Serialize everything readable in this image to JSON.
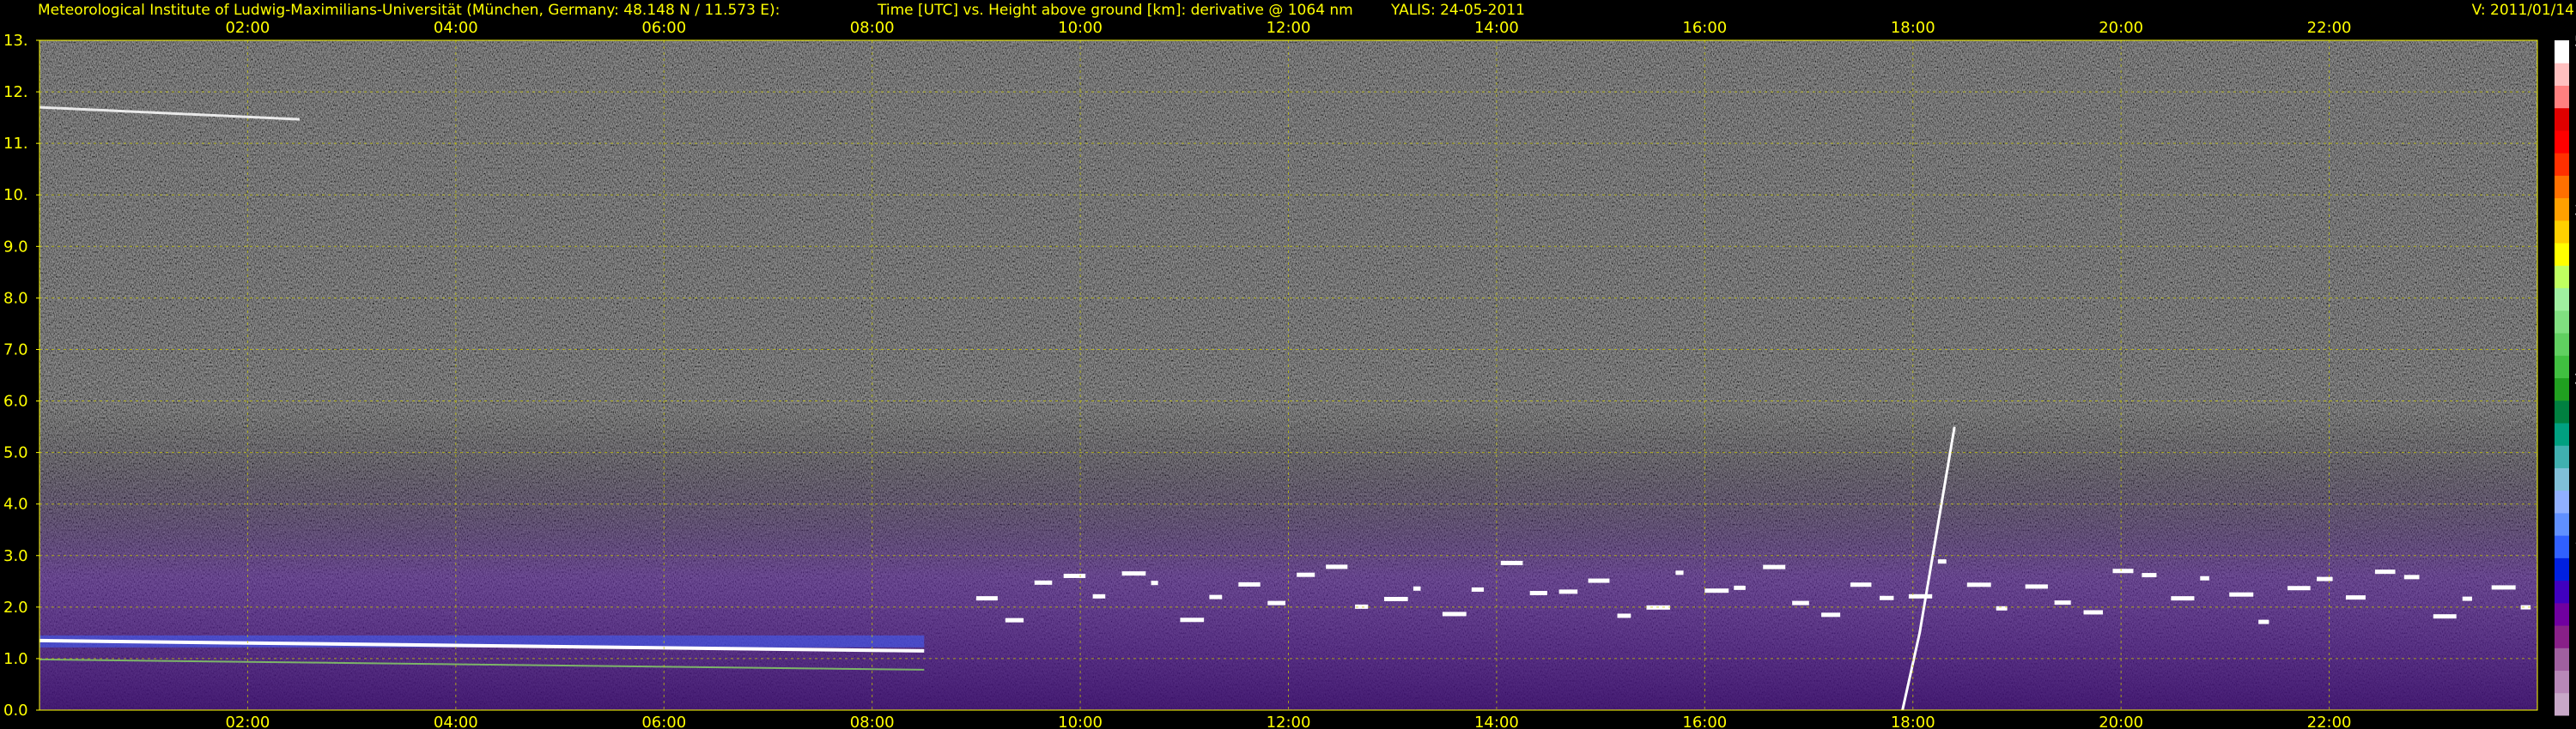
{
  "header": {
    "institute": "Meteorological Institute of Ludwig-Maximilians-Universität (München, Germany: 48.148 N / 11.573 E):",
    "title": "Time [UTC] vs. Height above ground [km]: derivative @ 1064 nm",
    "instrument": "YALIS: 24-05-2011",
    "version": "V: 2011/01/14"
  },
  "colors": {
    "text": "#ffff00",
    "grid": "#c8c800",
    "background": "#000000",
    "colorbar_text": "#ffffff"
  },
  "chart_data": {
    "type": "heatmap",
    "title": "Time [UTC] vs. Height above ground [km]: derivative @ 1064 nm",
    "xlabel": "Time [UTC]",
    "ylabel": "Height above ground [km]",
    "x_ticks": [
      "02:00",
      "04:00",
      "06:00",
      "08:00",
      "10:00",
      "12:00",
      "14:00",
      "16:00",
      "18:00",
      "20:00",
      "22:00"
    ],
    "x_tick_hours": [
      2,
      4,
      6,
      8,
      10,
      12,
      14,
      16,
      18,
      20,
      22
    ],
    "xlim_hours": [
      0,
      24
    ],
    "y_ticks": [
      "0.0",
      "1.0",
      "2.0",
      "3.0",
      "4.0",
      "5.0",
      "6.0",
      "7.0",
      "8.0",
      "9.0",
      "10.",
      "11.",
      "12.",
      "13."
    ],
    "y_tick_values": [
      0,
      1,
      2,
      3,
      4,
      5,
      6,
      7,
      8,
      9,
      10,
      11,
      12,
      13
    ],
    "ylim_km": [
      0,
      13
    ],
    "grid": true,
    "colorbar": {
      "range": [
        0,
        5
      ],
      "ticks": [
        "1.25",
        "2.50",
        "3.75",
        "5.00"
      ],
      "tick_values": [
        1.25,
        2.5,
        3.75,
        5.0
      ],
      "palette": [
        "#c8a8c8",
        "#b888b8",
        "#a060a0",
        "#882088",
        "#7000a0",
        "#4000c0",
        "#0020e0",
        "#3060ff",
        "#6090ff",
        "#90b0ff",
        "#80c0d8",
        "#40b0b0",
        "#00a080",
        "#008040",
        "#20a020",
        "#40c040",
        "#60d060",
        "#80e080",
        "#a0f0a0",
        "#c0ff60",
        "#ffff00",
        "#ffd000",
        "#ffa000",
        "#ff7000",
        "#ff3000",
        "#ff0000",
        "#e00000",
        "#ff8080",
        "#ffc0c0",
        "#ffffff"
      ]
    },
    "features": [
      {
        "name": "boundary layer aerosol top",
        "t_start": 0.0,
        "t_end": 8.5,
        "height_km": 1.35
      },
      {
        "name": "cirrus trace",
        "t_start": 0.0,
        "t_end": 2.5,
        "height_km": 11.7
      },
      {
        "name": "cumulus cloud bases",
        "t_start": 9.0,
        "t_end": 24.0,
        "height_km": 2.3
      },
      {
        "name": "convective plume",
        "t_start": 17.9,
        "t_end": 18.4,
        "height_km": 5.5
      }
    ]
  }
}
